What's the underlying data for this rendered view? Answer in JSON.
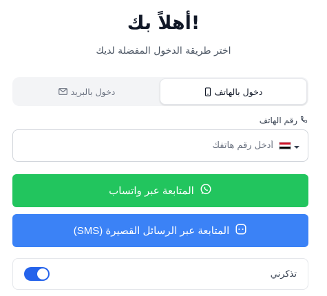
{
  "header": {
    "title": "أهلاً بك!",
    "subtitle": "اختر طريقة الدخول المفضلة لديك"
  },
  "tabs": [
    {
      "label": "دخول بالهاتف",
      "icon": "phone-icon",
      "active": true
    },
    {
      "label": "دخول بالبريد",
      "icon": "mail-icon",
      "active": false
    }
  ],
  "phone": {
    "label": "رقم الهاتف",
    "label_icon": "phone-handset-icon",
    "placeholder": "أدخل رقم هاتفك",
    "country_flag": "egypt-flag-icon"
  },
  "buttons": {
    "whatsapp": {
      "label": "المتابعة عبر واتساب",
      "icon": "whatsapp-icon",
      "color": "#22c55e"
    },
    "sms": {
      "label": "المتابعة عبر الرسائل القصيرة (SMS)",
      "icon": "message-icon",
      "color": "#3b82f6"
    }
  },
  "remember": {
    "label": "تذكرني",
    "enabled": true,
    "color": "#2563eb"
  }
}
